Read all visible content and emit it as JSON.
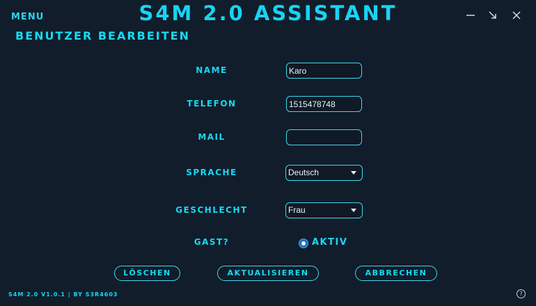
{
  "window": {
    "menu_label": "Menu",
    "title": "S4M 2.0 Assistant",
    "controls": [
      "minimize-icon",
      "restore-icon",
      "close-icon"
    ]
  },
  "page": {
    "title": "Benutzer bearbeiten"
  },
  "form": {
    "name": {
      "label": "Name",
      "value": "Karo"
    },
    "telefon": {
      "label": "Telefon",
      "value": "1515478748"
    },
    "mail": {
      "label": "Mail",
      "value": ""
    },
    "sprache": {
      "label": "Sprache",
      "selected": "Deutsch"
    },
    "geschlecht": {
      "label": "Geschlecht",
      "selected": "Frau"
    },
    "gast": {
      "label": "Gast?",
      "option_label": "Aktiv",
      "checked": true
    }
  },
  "buttons": {
    "delete": "Löschen",
    "update": "Aktualisieren",
    "cancel": "Abbrechen"
  },
  "footer": {
    "version_text": "S4M 2.0 v1.0.1 | by S3R4603",
    "help_icon": "question-circle-icon"
  },
  "colors": {
    "background": "#111d2b",
    "accent": "#17d9f0",
    "radio_fill": "#1b6fbf"
  }
}
